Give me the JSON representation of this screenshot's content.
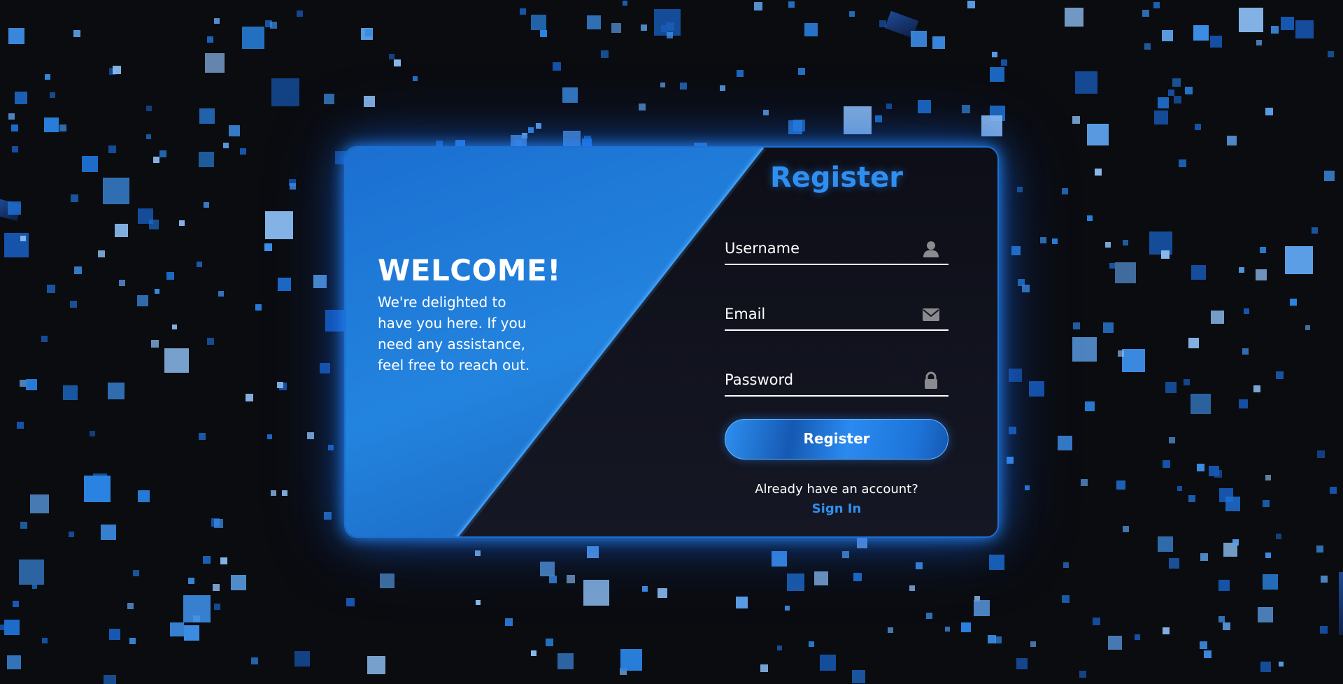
{
  "welcome": {
    "heading": "WELCOME!",
    "message": "We're delighted to have you here. If you need any assistance, feel free to reach out."
  },
  "form": {
    "title": "Register",
    "username_label": "Username",
    "email_label": "Email",
    "password_label": "Password",
    "submit_label": "Register",
    "already_text": "Already have an account?",
    "signin_label": "Sign In"
  },
  "icons": {
    "username": "user-icon",
    "email": "envelope-icon",
    "password": "lock-icon"
  },
  "colors": {
    "accent": "#2f8ff0",
    "background": "#0b0c10",
    "panel": "#12131d",
    "glow": "#1d6fd0"
  }
}
